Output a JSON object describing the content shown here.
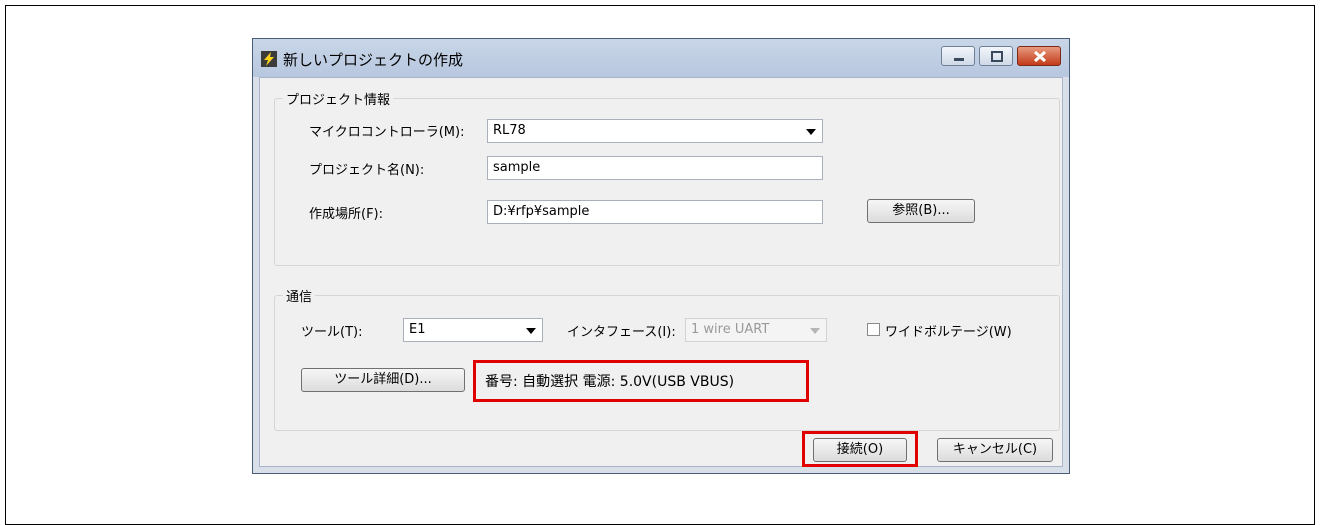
{
  "window": {
    "title": "新しいプロジェクトの作成",
    "icon": "lightning-icon"
  },
  "project_info": {
    "group_title": "プロジェクト情報",
    "microcontroller": {
      "label": "マイクロコントローラ(M):",
      "value": "RL78"
    },
    "project_name": {
      "label": "プロジェクト名(N):",
      "value": "sample"
    },
    "location": {
      "label": "作成場所(F):",
      "value": "D:¥rfp¥sample"
    },
    "browse_label": "参照(B)..."
  },
  "communication": {
    "group_title": "通信",
    "tool": {
      "label": "ツール(T):",
      "value": "E1"
    },
    "interface": {
      "label": "インタフェース(I):",
      "value": "1 wire UART"
    },
    "wide_voltage": {
      "label": "ワイドボルテージ(W)",
      "checked": false
    },
    "tool_details_label": "ツール詳細(D)...",
    "tool_info_text": "番号: 自動選択  電源: 5.0V(USB VBUS)"
  },
  "footer": {
    "connect_label": "接続(O)",
    "cancel_label": "キャンセル(C)"
  },
  "colors": {
    "highlight": "#e00000",
    "titlebar": "#b7c7df",
    "close_button": "#c23a18"
  }
}
